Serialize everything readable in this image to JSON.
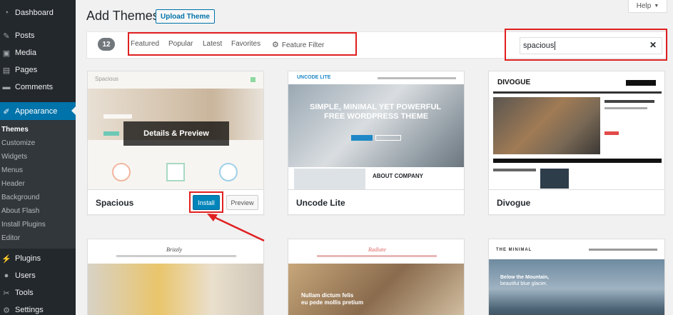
{
  "sidebar": {
    "items": [
      {
        "label": "Dashboard",
        "icon": "dashboard-icon"
      },
      {
        "label": "Posts",
        "icon": "pin-icon"
      },
      {
        "label": "Media",
        "icon": "media-icon"
      },
      {
        "label": "Pages",
        "icon": "pages-icon"
      },
      {
        "label": "Comments",
        "icon": "comment-icon"
      },
      {
        "label": "Appearance",
        "icon": "brush-icon"
      }
    ],
    "submenu": [
      "Themes",
      "Customize",
      "Widgets",
      "Menus",
      "Header",
      "Background",
      "About Flash",
      "Install Plugins",
      "Editor"
    ],
    "lower_items": [
      {
        "label": "Plugins",
        "icon": "plugin-icon"
      },
      {
        "label": "Users",
        "icon": "users-icon"
      },
      {
        "label": "Tools",
        "icon": "wrench-icon"
      },
      {
        "label": "Settings",
        "icon": "settings-icon"
      }
    ]
  },
  "header": {
    "title": "Add Themes",
    "upload_label": "Upload Theme",
    "help_label": "Help"
  },
  "filter_bar": {
    "count": "12",
    "tabs": [
      "Featured",
      "Popular",
      "Latest",
      "Favorites"
    ],
    "feature_filter": "Feature Filter",
    "search_value": "spacious"
  },
  "themes": [
    {
      "name": "Spacious",
      "overlay": "Details & Preview",
      "install": "Install",
      "preview": "Preview",
      "shot_title": "Spacious"
    },
    {
      "name": "Uncode Lite",
      "shot_logo": "UNCODE LITE",
      "shot_headline_1": "SIMPLE, MINIMAL YET POWERFUL",
      "shot_headline_2": "FREE WORDPRESS THEME",
      "shot_about": "ABOUT COMPANY"
    },
    {
      "name": "Divogue",
      "shot_logo": "DIVOGUE"
    },
    {
      "name": "",
      "shot_logo": "Brizzly"
    },
    {
      "name": "",
      "shot_logo": "Radiate",
      "shot_text_1": "Nullam dictum felis",
      "shot_text_2": "eu pede mollis pretium"
    },
    {
      "name": "",
      "shot_logo": "THE MINIMAL",
      "shot_text_1": "Below the Mountain,",
      "shot_text_2": "beautiful blue glacier,"
    }
  ],
  "colors": {
    "sidebar_bg": "#23282d",
    "active_bg": "#0073aa",
    "annotation_red": "#e02020",
    "install_blue": "#0085ba"
  }
}
